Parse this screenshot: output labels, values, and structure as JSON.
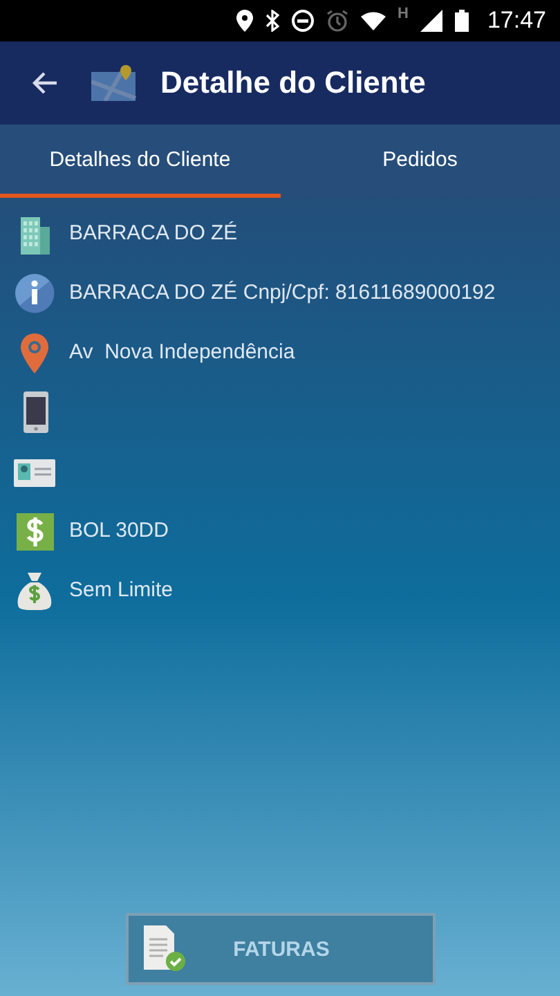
{
  "status_bar": {
    "network": "H",
    "time": "17:47"
  },
  "app_bar": {
    "title": "Detalhe do Cliente"
  },
  "tabs": [
    {
      "label": "Detalhes do Cliente",
      "selected": true
    },
    {
      "label": "Pedidos",
      "selected": false
    }
  ],
  "details": [
    {
      "kind": "building",
      "text": "BARRACA DO ZÉ"
    },
    {
      "kind": "info",
      "text": "BARRACA DO ZÉ Cnpj/Cpf: 81611689000192"
    },
    {
      "kind": "pin",
      "text": "Av  Nova Independência"
    },
    {
      "kind": "phone"
    },
    {
      "kind": "card"
    },
    {
      "kind": "money",
      "text": "BOL 30DD"
    },
    {
      "kind": "bag",
      "text": "Sem Limite"
    }
  ],
  "invoice_button": {
    "label": "FATURAS",
    "disabled": true
  }
}
